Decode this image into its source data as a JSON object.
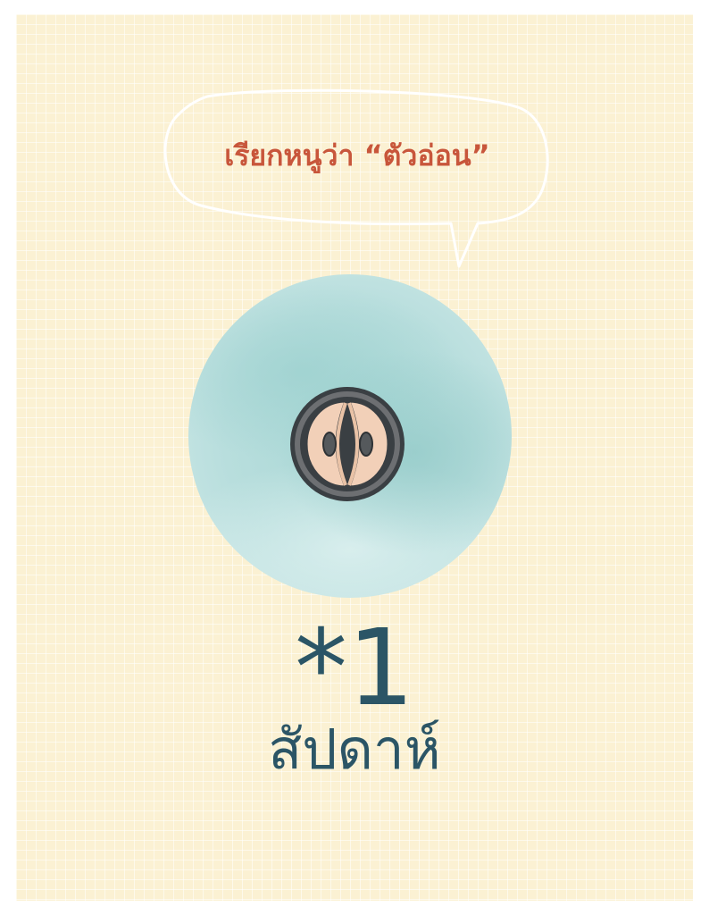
{
  "speech_bubble": {
    "text": "เรียกหนูว่า “ตัวอ่อน”"
  },
  "illustration": {
    "icon": "two-cell-embryo-icon"
  },
  "milestone": {
    "number": "*1",
    "unit": "สัปดาห์"
  },
  "colors": {
    "background": "#fbf1d3",
    "bubble_text": "#c8563b",
    "circle": "#a9d7d5",
    "number_text": "#2b5566"
  }
}
